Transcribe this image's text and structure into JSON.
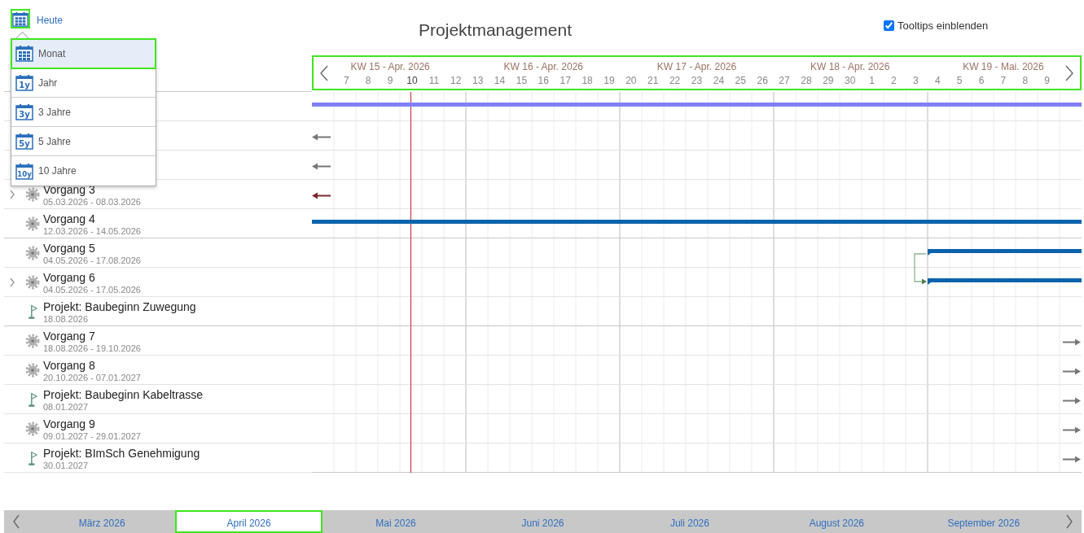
{
  "header": {
    "calendar_button": {
      "focused": true
    },
    "today_link": "Heute",
    "title": "Projektmanagement",
    "tooltips": {
      "label": "Tooltips einblenden",
      "checked": true
    }
  },
  "view_menu": {
    "items": [
      {
        "label": "Monat",
        "kind": "grid",
        "selected": true
      },
      {
        "label": "Jahr",
        "kind": "years",
        "icon_text": "1y",
        "selected": false
      },
      {
        "label": "3 Jahre",
        "kind": "years",
        "icon_text": "3y",
        "selected": false
      },
      {
        "label": "5 Jahre",
        "kind": "years",
        "icon_text": "5y",
        "selected": false
      },
      {
        "label": "10 Jahre",
        "kind": "years",
        "icon_text": "10y",
        "selected": false
      }
    ]
  },
  "timeline": {
    "focused": true,
    "weeks": [
      {
        "label": "KW 15 - Apr. 2026",
        "days": [
          {
            "label": "7",
            "today": false
          },
          {
            "label": "8",
            "today": false
          },
          {
            "label": "9",
            "today": false
          },
          {
            "label": "10",
            "today": true
          },
          {
            "label": "11",
            "today": false
          },
          {
            "label": "12",
            "today": false
          }
        ]
      },
      {
        "label": "KW 16 - Apr. 2026",
        "days": [
          {
            "label": "13",
            "today": false
          },
          {
            "label": "14",
            "today": false
          },
          {
            "label": "15",
            "today": false
          },
          {
            "label": "16",
            "today": false
          },
          {
            "label": "17",
            "today": false
          },
          {
            "label": "18",
            "today": false
          },
          {
            "label": "19",
            "today": false
          }
        ]
      },
      {
        "label": "KW 17 - Apr. 2026",
        "days": [
          {
            "label": "20",
            "today": false
          },
          {
            "label": "21",
            "today": false
          },
          {
            "label": "22",
            "today": false
          },
          {
            "label": "23",
            "today": false
          },
          {
            "label": "24",
            "today": false
          },
          {
            "label": "25",
            "today": false
          },
          {
            "label": "26",
            "today": false
          }
        ]
      },
      {
        "label": "KW 18 - Apr. 2026",
        "days": [
          {
            "label": "27",
            "today": false
          },
          {
            "label": "28",
            "today": false
          },
          {
            "label": "29",
            "today": false
          },
          {
            "label": "30",
            "today": false
          },
          {
            "label": "1",
            "today": false
          },
          {
            "label": "2",
            "today": false
          },
          {
            "label": "3",
            "today": false
          }
        ]
      },
      {
        "label": "KW 19 - Mai. 2026",
        "days": [
          {
            "label": "4",
            "today": false
          },
          {
            "label": "5",
            "today": false
          },
          {
            "label": "6",
            "today": false
          },
          {
            "label": "7",
            "today": false
          },
          {
            "label": "8",
            "today": false
          },
          {
            "label": "9",
            "today": false
          }
        ]
      }
    ]
  },
  "rows": [
    {
      "gantt": {
        "kind": "bar-full",
        "color": "#8080f6"
      }
    },
    {
      "gantt": {
        "kind": "arrow-left",
        "color": "#777777"
      }
    },
    {
      "gantt": {
        "kind": "arrow-left",
        "color": "#777777"
      }
    },
    {
      "name": "Vorgang 3",
      "dates": "05.03.2026 - 08.03.2026",
      "kind": "task",
      "has_children": true,
      "gantt": {
        "kind": "arrow-left",
        "color": "#7a2a2a"
      }
    },
    {
      "name": "Vorgang 4",
      "dates": "12.03.2026 - 14.05.2026",
      "kind": "task",
      "has_children": false,
      "gantt": {
        "kind": "bar-full",
        "color": "#0b63ab"
      }
    },
    {
      "name": "Vorgang 5",
      "dates": "04.05.2026 - 17.08.2026",
      "kind": "task",
      "has_children": false,
      "gantt": {
        "kind": "bar-from",
        "color": "#0b63ab"
      }
    },
    {
      "name": "Vorgang 6",
      "dates": "04.05.2026 - 17.05.2026",
      "kind": "task",
      "has_children": true,
      "gantt": {
        "kind": "bar-from",
        "color": "#0b63ab",
        "link_from_previous": true
      }
    },
    {
      "name": "Projekt: Baubeginn Zuwegung",
      "dates": "18.08.2026",
      "kind": "milestone",
      "has_children": false,
      "gantt": {
        "kind": "none"
      }
    },
    {
      "name": "Vorgang 7",
      "dates": "18.08.2026 - 19.10.2026",
      "kind": "task",
      "has_children": false,
      "gantt": {
        "kind": "arrow-right",
        "color": "#777777"
      }
    },
    {
      "name": "Vorgang 8",
      "dates": "20.10.2026 - 07.01.2027",
      "kind": "task",
      "has_children": false,
      "gantt": {
        "kind": "arrow-right",
        "color": "#777777"
      }
    },
    {
      "name": "Projekt: Baubeginn Kabeltrasse",
      "dates": "08.01.2027",
      "kind": "milestone",
      "has_children": false,
      "gantt": {
        "kind": "arrow-right",
        "color": "#777777"
      }
    },
    {
      "name": "Vorgang 9",
      "dates": "09.01.2027 - 29.01.2027",
      "kind": "task",
      "has_children": false,
      "gantt": {
        "kind": "arrow-right",
        "color": "#777777"
      }
    },
    {
      "name": "Projekt: BImSch Genehmigung",
      "dates": "30.01.2027",
      "kind": "milestone",
      "has_children": false,
      "gantt": {
        "kind": "arrow-right",
        "color": "#777777"
      }
    }
  ],
  "months": [
    {
      "label": "März 2026",
      "selected": false
    },
    {
      "label": "April 2026",
      "selected": true
    },
    {
      "label": "Mai 2026",
      "selected": false
    },
    {
      "label": "Juni 2026",
      "selected": false
    },
    {
      "label": "Juli 2026",
      "selected": false
    },
    {
      "label": "August 2026",
      "selected": false
    },
    {
      "label": "September 2026",
      "selected": false
    }
  ]
}
